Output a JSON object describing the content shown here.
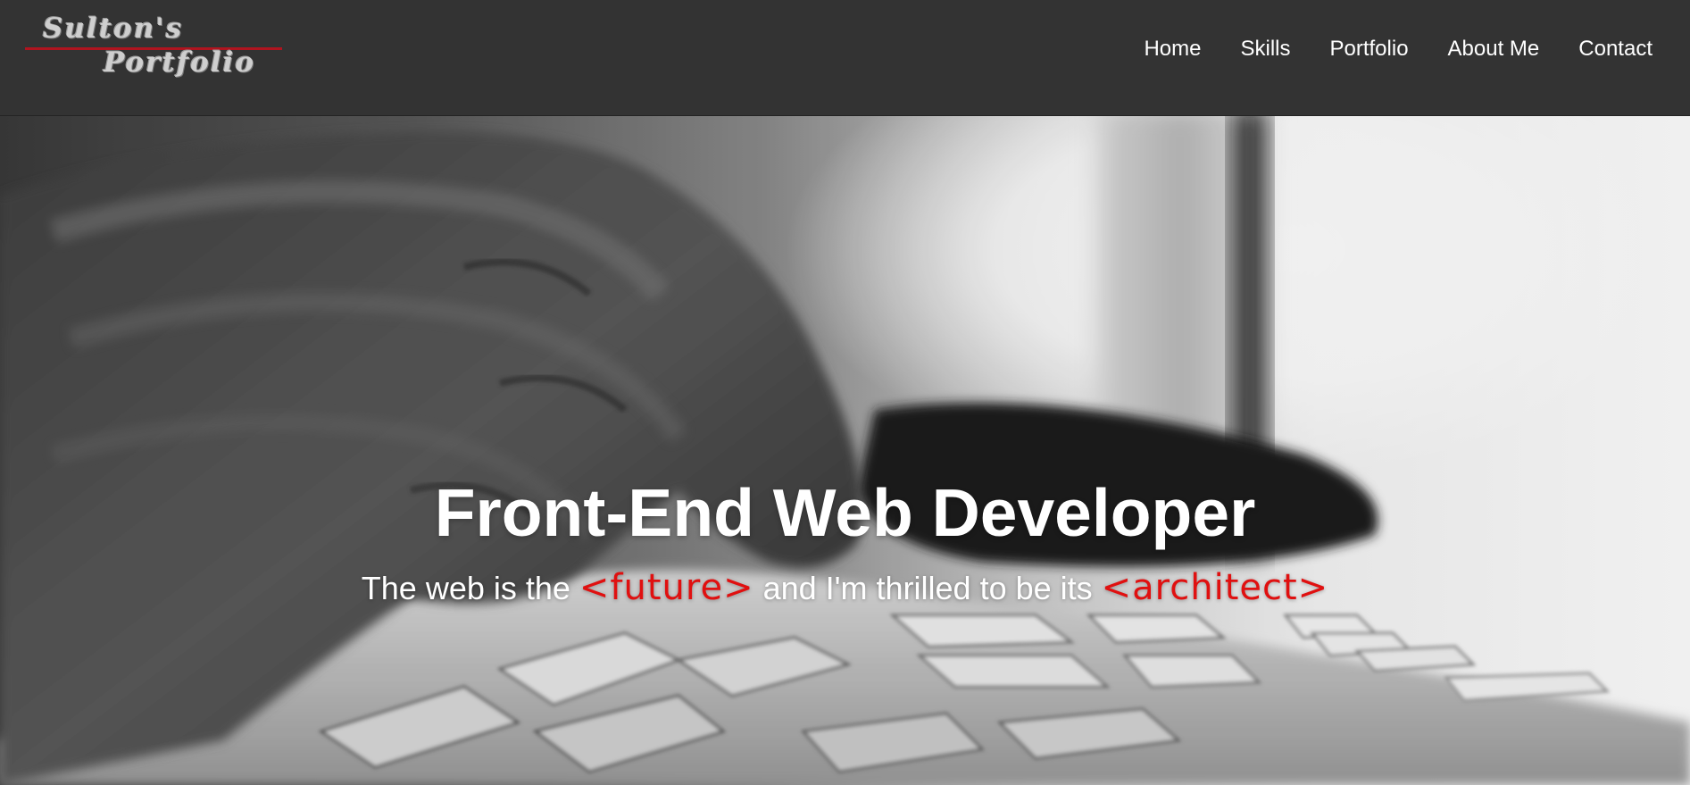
{
  "header": {
    "logo_line1": "Sulton's",
    "logo_line2": "Portfolio",
    "nav": [
      {
        "label": "Home"
      },
      {
        "label": "Skills"
      },
      {
        "label": "Portfolio"
      },
      {
        "label": "About Me"
      },
      {
        "label": "Contact"
      }
    ]
  },
  "hero": {
    "title": "Front-End Web Developer",
    "tagline_part1": "The web is the ",
    "tagline_accent1": "<future>",
    "tagline_part2": " and I'm thrilled to be its ",
    "tagline_accent2": "<architect>"
  },
  "colors": {
    "header_bg": "#333333",
    "logo_rule": "#b0141f",
    "accent": "#e01010",
    "text": "#ffffff"
  }
}
